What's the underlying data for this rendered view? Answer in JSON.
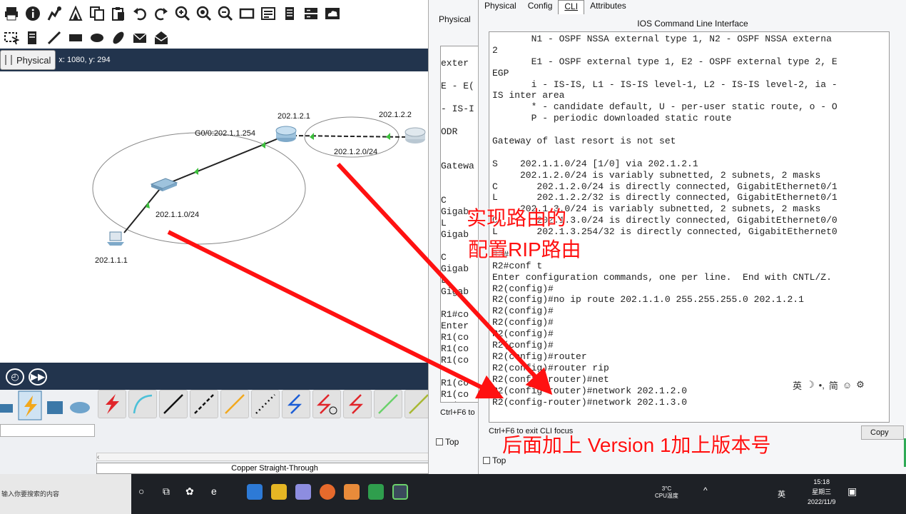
{
  "main_window": {
    "workspace_tab": "Physical",
    "coords": "x: 1080, y: 294",
    "network": {
      "gateway_label": "G0/0:202.1.1.254",
      "r1_ip": "202.1.2.1",
      "r2_ip": "202.1.2.2",
      "link_net": "202.1.2.0/24",
      "lan_net": "202.1.1.0/24",
      "pc_ip": "202.1.1.1"
    },
    "cable_name": "Copper Straight-Through"
  },
  "r1_window": {
    "tab_label": "Physical",
    "terminal_lines": [
      "",
      "exter",
      "",
      "E - E(",
      "",
      "- IS-I",
      "",
      "ODR",
      "",
      "",
      "Gatewa",
      "",
      "",
      "C",
      "Gigab",
      "L",
      "Gigab",
      "",
      "C",
      "Gigab",
      "L",
      "Gigab",
      "",
      "R1#co",
      "Enter",
      "R1(co",
      "R1(co",
      "R1(co",
      "",
      "R1(co",
      "R1(co",
      "R1(co"
    ],
    "footer_hint": "Ctrl+F6 to",
    "top_label": "Top"
  },
  "r2_window": {
    "tabs": [
      "Physical",
      "Config",
      "CLI",
      "Attributes"
    ],
    "active_tab": "CLI",
    "cli_title": "IOS Command Line Interface",
    "cli_lines": [
      "       N1 - OSPF NSSA external type 1, N2 - OSPF NSSA externa",
      "2",
      "       E1 - OSPF external type 1, E2 - OSPF external type 2, E",
      "EGP",
      "       i - IS-IS, L1 - IS-IS level-1, L2 - IS-IS level-2, ia -",
      "IS inter area",
      "       * - candidate default, U - per-user static route, o - O",
      "       P - periodic downloaded static route",
      "",
      "Gateway of last resort is not set",
      "",
      "S    202.1.1.0/24 [1/0] via 202.1.2.1",
      "     202.1.2.0/24 is variably subnetted, 2 subnets, 2 masks",
      "C       202.1.2.0/24 is directly connected, GigabitEthernet0/1",
      "L       202.1.2.2/32 is directly connected, GigabitEthernet0/1",
      "     202.1.3.0/24 is variably subnetted, 2 subnets, 2 masks",
      "C       202.1.3.0/24 is directly connected, GigabitEthernet0/0",
      "L       202.1.3.254/32 is directly connected, GigabitEthernet0",
      "",
      "R2#",
      "R2#conf t",
      "Enter configuration commands, one per line.  End with CNTL/Z.",
      "R2(config)#",
      "R2(config)#no ip route 202.1.1.0 255.255.255.0 202.1.2.1",
      "R2(config)#",
      "R2(config)#",
      "R2(config)#",
      "R2(config)#",
      "R2(config)#router",
      "R2(config)#router rip",
      "R2(config-router)#net",
      "R2(config-router)#network 202.1.2.0",
      "R2(config-router)#network 202.1.3.0"
    ],
    "exit_hint": "Ctrl+F6 to exit CLI focus",
    "copy_label": "Copy",
    "top_label": "Top",
    "ime": {
      "lang": "英",
      "mode": "简"
    }
  },
  "annotations": {
    "line1": "实现路由的",
    "line2": "配置RIP路由",
    "line3": "后面加上 Version 1加上版本号",
    "color": "#ff1111"
  },
  "taskbar": {
    "search_placeholder": "输入你要搜索的内容",
    "weather_temp": "3°C",
    "weather_label": "CPU温度",
    "lang": "英",
    "time": "15:18",
    "weekday": "星期三",
    "date": "2022/11/9"
  }
}
